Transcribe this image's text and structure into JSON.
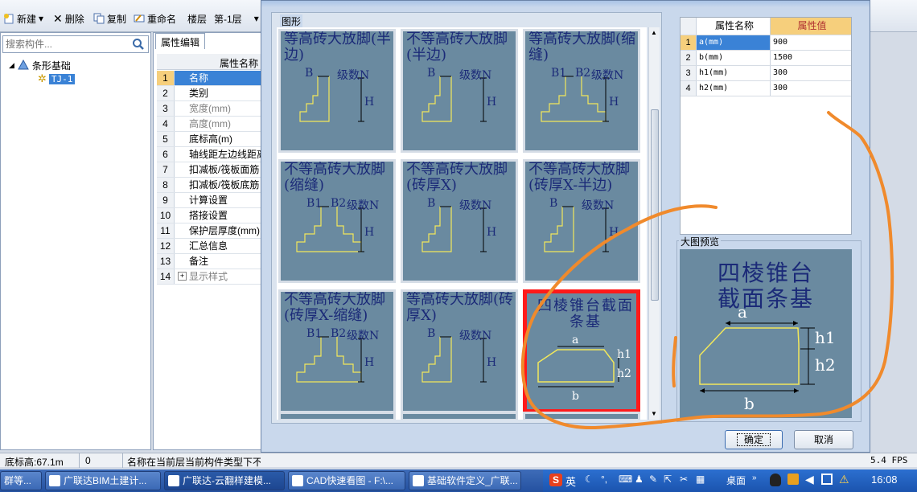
{
  "toolbar": {
    "new_label": "新建",
    "delete_label": "删除",
    "copy_label": "复制",
    "rename_label": "重命名",
    "floor_label": "楼层",
    "floor_value": "第-1层"
  },
  "leftpanel": {
    "search_placeholder": "搜索构件...",
    "tree_root": "条形基础",
    "tree_child": "TJ-1"
  },
  "proppanel": {
    "tab": "属性编辑",
    "header": "属性名称",
    "rows": [
      {
        "n": "1",
        "name": "名称"
      },
      {
        "n": "2",
        "name": "类别"
      },
      {
        "n": "3",
        "name": "宽度(mm)"
      },
      {
        "n": "4",
        "name": "高度(mm)"
      },
      {
        "n": "5",
        "name": "底标高(m)"
      },
      {
        "n": "6",
        "name": "轴线距左边线距离"
      },
      {
        "n": "7",
        "name": "扣减板/筏板面筋"
      },
      {
        "n": "8",
        "name": "扣减板/筏板底筋"
      },
      {
        "n": "9",
        "name": "计算设置"
      },
      {
        "n": "10",
        "name": "搭接设置"
      },
      {
        "n": "11",
        "name": "保护层厚度(mm)"
      },
      {
        "n": "12",
        "name": "汇总信息"
      },
      {
        "n": "13",
        "name": "备注"
      },
      {
        "n": "14",
        "name": "显示样式",
        "expand": "+"
      }
    ]
  },
  "dialog": {
    "group_label": "图形",
    "tiles": [
      {
        "title": "等高砖大放脚(半边)",
        "labels": [
          "B",
          "级数N",
          "H"
        ]
      },
      {
        "title": "不等高砖大放脚(半边)",
        "labels": [
          "B",
          "级数N",
          "H"
        ]
      },
      {
        "title": "等高砖大放脚(缩缝)",
        "labels": [
          "B1",
          "B2",
          "级数N",
          "H"
        ]
      },
      {
        "title": "不等高砖大放脚(缩缝)",
        "labels": [
          "B1",
          "B2",
          "级数N",
          "H"
        ]
      },
      {
        "title": "不等高砖大放脚(砖厚X)",
        "labels": [
          "B",
          "级数N",
          "H"
        ]
      },
      {
        "title": "不等高砖大放脚(砖厚X-半边)",
        "labels": [
          "B",
          "级数N",
          "H"
        ]
      },
      {
        "title": "不等高砖大放脚(砖厚X-缩缝)",
        "labels": [
          "B1",
          "B2",
          "级数N",
          "H"
        ]
      },
      {
        "title": "等高砖大放脚(砖厚X)",
        "labels": [
          "B",
          "级数N",
          "H"
        ]
      },
      {
        "title": "四棱锥台截面条基",
        "labels": [
          "a",
          "h1",
          "h2",
          "b"
        ],
        "selected": true
      }
    ],
    "prop_table": {
      "col_name": "属性名称",
      "col_value": "属性值",
      "rows": [
        {
          "n": "1",
          "key": "a(mm)",
          "value": "900"
        },
        {
          "n": "2",
          "key": "b(mm)",
          "value": "1500"
        },
        {
          "n": "3",
          "key": "h1(mm)",
          "value": "300"
        },
        {
          "n": "4",
          "key": "h2(mm)",
          "value": "300"
        }
      ]
    },
    "preview_label": "大图预览",
    "preview_title_line1": "四棱锥台",
    "preview_title_line2": "截面条基",
    "preview_labels": {
      "a": "a",
      "h1": "h1",
      "h2": "h2",
      "b": "b"
    },
    "ok_label": "确定",
    "cancel_label": "取消"
  },
  "statusbar": {
    "elevation": "底标高:67.1m",
    "zero": "0",
    "message": "名称在当前层当前构件类型下不允许重名",
    "fps": "5.4 FPS"
  },
  "taskbar": {
    "items": [
      {
        "label": "群等..."
      },
      {
        "label": "广联达BIM土建计..."
      },
      {
        "label": "广联达-云翻样建模..."
      },
      {
        "label": "CAD快速看图 - F:\\..."
      },
      {
        "label": "基础软件定义_广联..."
      }
    ],
    "tray_desktop": "桌面",
    "tray_ime": "英",
    "clock": "16:08"
  },
  "colors": {
    "tile_bg": "#6a8aa0",
    "tile_title": "#1b2a78",
    "shape_yellow": "#f2e85a",
    "selected_border": "#ff1a1a",
    "accent_header": "#f6cf7c",
    "selection_blue": "#3a82d6"
  }
}
